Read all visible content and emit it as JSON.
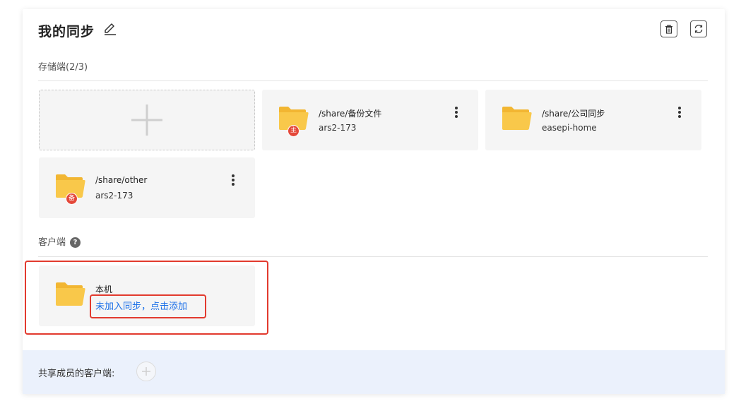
{
  "header": {
    "title": "我的同步",
    "icons": [
      "edit-icon",
      "trash-icon",
      "refresh-icon"
    ]
  },
  "storage": {
    "label": "存储端(2/3)",
    "cards": [
      {
        "path": "/share/备份文件",
        "device": "ars2-173",
        "badge": "主"
      },
      {
        "path": "/share/公司同步",
        "device": "easepi-home",
        "badge": ""
      },
      {
        "path": "/share/other",
        "device": "ars2-173",
        "badge": "备"
      }
    ]
  },
  "client": {
    "label": "客户端",
    "help": "?",
    "card": {
      "name": "本机",
      "action": "未加入同步，点击添加"
    }
  },
  "footer": {
    "label": "共享成员的客户端:"
  },
  "colors": {
    "folder": "#f9c84a",
    "folder_dark": "#f2b632",
    "badge": "#e4483a",
    "link": "#1a6fe8",
    "highlight": "#e23a2e",
    "footer_bg": "#ebf1fc"
  }
}
